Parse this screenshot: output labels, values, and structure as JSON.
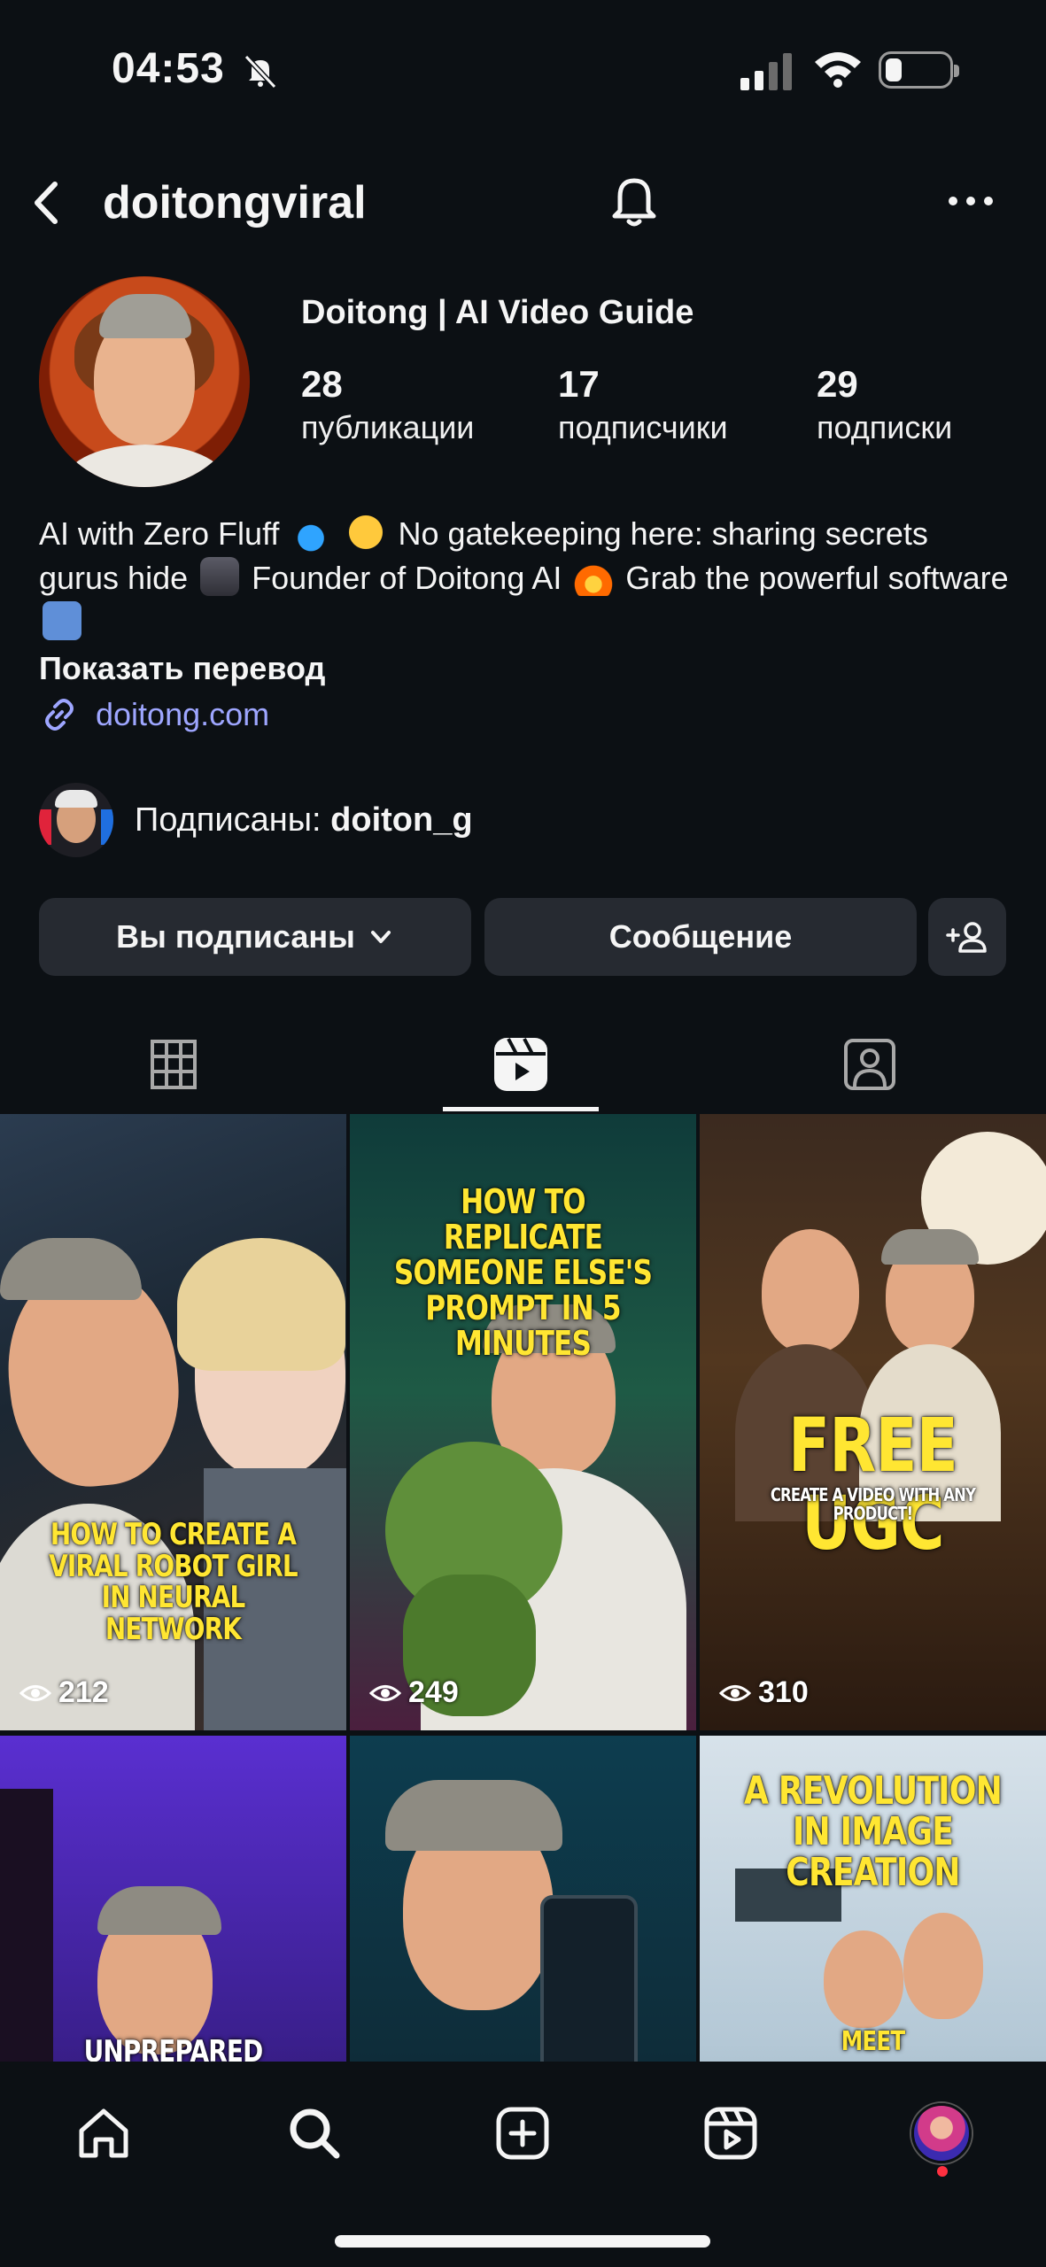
{
  "status_bar": {
    "time": "04:53"
  },
  "header": {
    "username": "doitongviral"
  },
  "profile": {
    "display_name": "Doitong | AI Video Guide",
    "stats": [
      {
        "value": "28",
        "label": "публикации"
      },
      {
        "value": "17",
        "label": "подписчики"
      },
      {
        "value": "29",
        "label": "подписки"
      }
    ],
    "bio": {
      "part1": "AI with Zero Fluff",
      "part2": "No gatekeeping here: sharing secrets gurus hide",
      "part3": "Founder of Doitong AI",
      "part4": "Grab the powerful software"
    },
    "translate_label": "Показать перевод",
    "link": "doitong.com",
    "followed_by_prefix": "Подписаны:",
    "followed_by_user": "doiton_g"
  },
  "actions": {
    "following_label": "Вы подписаны",
    "message_label": "Сообщение"
  },
  "tabs": [
    "grid",
    "reels",
    "tagged"
  ],
  "reels": [
    {
      "caption": "HOW TO CREATE A VIRAL ROBOT GIRL IN NEURAL NETWORK",
      "views": "212"
    },
    {
      "caption": "HOW TO REPLICATE SOMEONE ELSE'S PROMPT IN 5 MINUTES",
      "views": "249"
    },
    {
      "caption": "FREE UGC",
      "subcaption": "CREATE A VIDEO WITH ANY PRODUCT!",
      "views": "310"
    },
    {
      "caption": "UNPREPARED"
    },
    {
      "caption": ""
    },
    {
      "caption": "A REVOLUTION IN IMAGE CREATION",
      "subcaption": "MEET"
    }
  ],
  "colors": {
    "background": "#0c1014",
    "button": "#262a31",
    "link": "#9ea6ff",
    "caption_yellow": "#ffe632",
    "notification": "#ff3040"
  },
  "icons": [
    "mute-bell-icon",
    "signal-icon",
    "wifi-icon",
    "battery-icon",
    "back-arrow-icon",
    "bell-icon",
    "more-icon",
    "link-icon",
    "chevron-down-icon",
    "add-user-icon",
    "grid-icon",
    "reels-icon",
    "tagged-icon",
    "eye-icon",
    "home-icon",
    "search-icon",
    "create-icon",
    "reels-nav-icon"
  ]
}
